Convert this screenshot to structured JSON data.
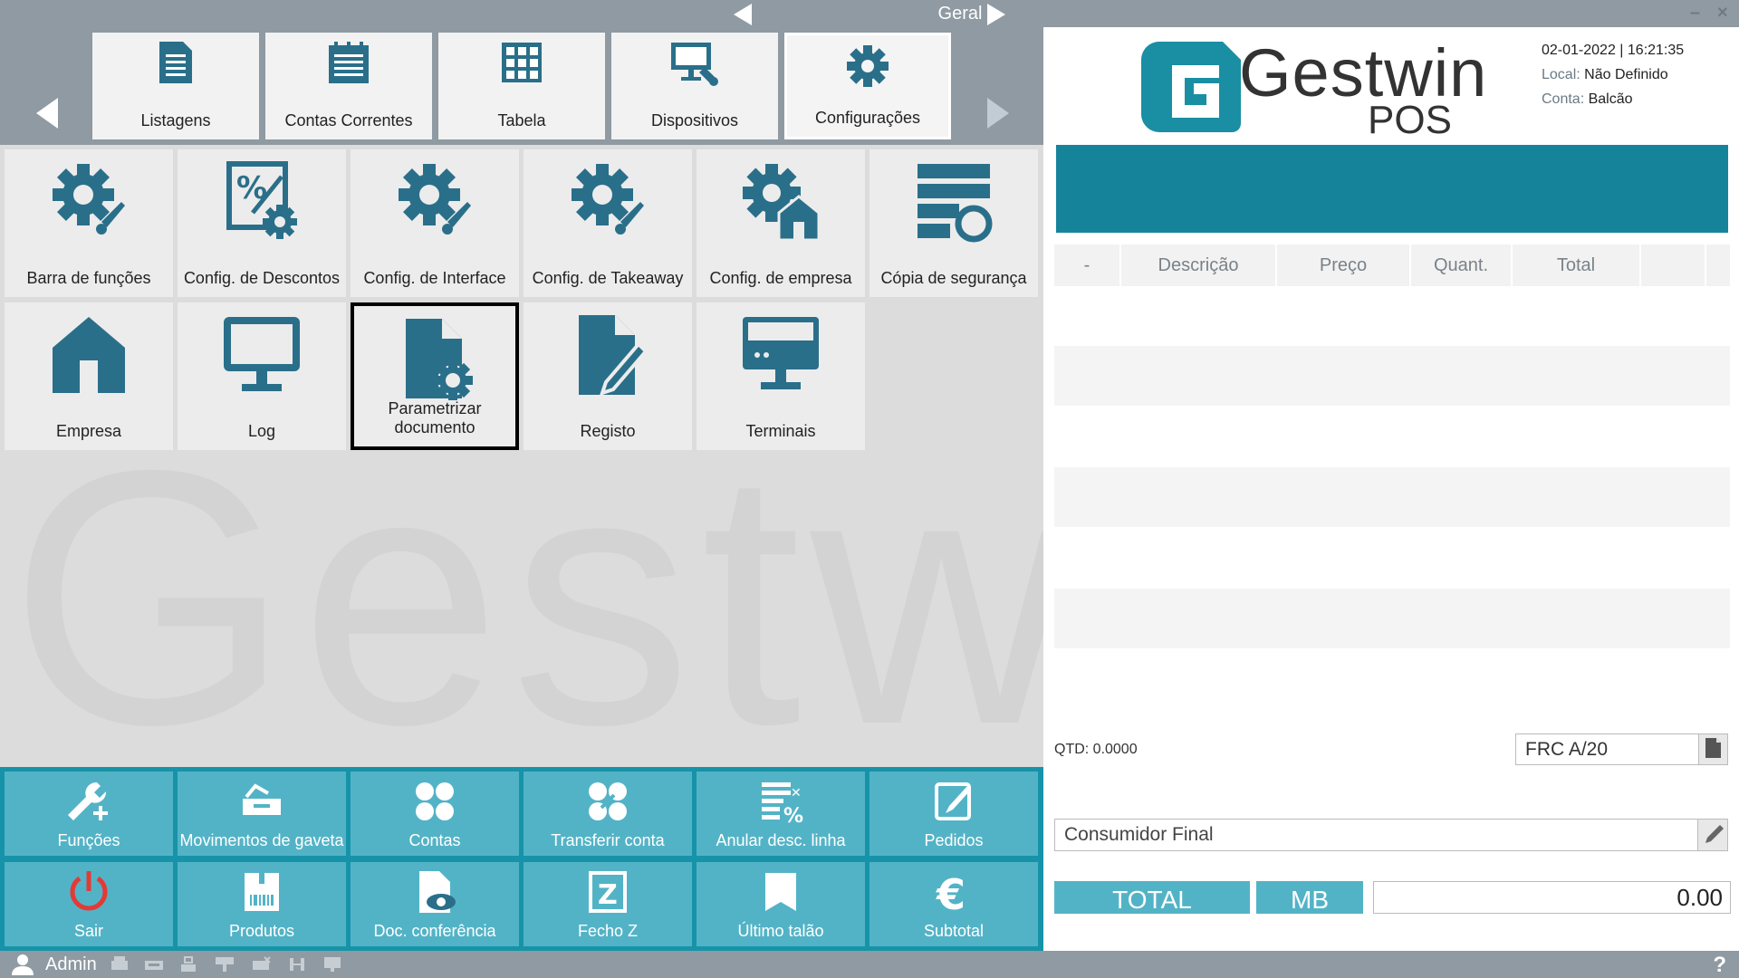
{
  "titlebar": {
    "title": "Geral"
  },
  "categories": [
    {
      "label": "Listagens",
      "icon": "document-list-icon"
    },
    {
      "label": "Contas Correntes",
      "icon": "notepad-icon"
    },
    {
      "label": "Tabela",
      "icon": "table-grid-icon"
    },
    {
      "label": "Dispositivos",
      "icon": "device-config-icon"
    },
    {
      "label": "Configurações",
      "icon": "gear-icon",
      "active": true
    }
  ],
  "tiles": [
    {
      "label": "Barra de funções",
      "icon": "gear-brush-icon"
    },
    {
      "label": "Config. de Descontos",
      "icon": "discount-gear-icon"
    },
    {
      "label": "Config. de Interface",
      "icon": "gear-brush-icon"
    },
    {
      "label": "Config. de Takeaway",
      "icon": "gear-brush-icon"
    },
    {
      "label": "Config. de empresa",
      "icon": "gear-house-icon"
    },
    {
      "label": "Cópia de segurança",
      "icon": "backup-icon"
    },
    {
      "label": "Empresa",
      "icon": "house-icon"
    },
    {
      "label": "Log",
      "icon": "monitor-icon"
    },
    {
      "label": "Parametrizar documento",
      "icon": "document-gear-icon",
      "selected": true
    },
    {
      "label": "Registo",
      "icon": "document-edit-icon"
    },
    {
      "label": "Terminais",
      "icon": "terminal-icon"
    }
  ],
  "functions": [
    {
      "label": "Funções",
      "icon": "wrench-plus-icon"
    },
    {
      "label": "Movimentos de gaveta",
      "icon": "cash-drawer-icon"
    },
    {
      "label": "Contas",
      "icon": "four-circles-icon"
    },
    {
      "label": "Transferir conta",
      "icon": "transfer-circles-icon"
    },
    {
      "label": "Anular desc. linha",
      "icon": "cancel-discount-icon"
    },
    {
      "label": "Pedidos",
      "icon": "edit-pencil-icon"
    },
    {
      "label": "Sair",
      "icon": "power-icon"
    },
    {
      "label": "Produtos",
      "icon": "barcode-box-icon"
    },
    {
      "label": "Doc. conferência",
      "icon": "document-eye-icon"
    },
    {
      "label": "Fecho Z",
      "icon": "z-box-icon"
    },
    {
      "label": "Último talão",
      "icon": "receipt-icon"
    },
    {
      "label": "Subtotal",
      "icon": "euro-icon"
    }
  ],
  "logo": {
    "name": "Gestwin",
    "sub": "POS"
  },
  "watermark": "Gestwin",
  "info": {
    "date": "02-01-2022",
    "time": "16:21:35",
    "local_label": "Local:",
    "local": "Não Definido",
    "conta_label": "Conta:",
    "conta": "Balcão"
  },
  "table": {
    "columns": [
      "-",
      "Descrição",
      "Preço",
      "Quant.",
      "Total",
      ""
    ]
  },
  "qtd": "QTD: 0.0000",
  "doc_type": "FRC A/20",
  "customer": "Consumidor Final",
  "total": {
    "label": "TOTAL",
    "payment": "MB",
    "value": "0.00"
  },
  "statusbar": {
    "user": "Admin"
  },
  "colors": {
    "accent": "#15849b",
    "button": "#53b3c6",
    "icon": "#2a6f8a",
    "bar": "#8f9aa2"
  }
}
